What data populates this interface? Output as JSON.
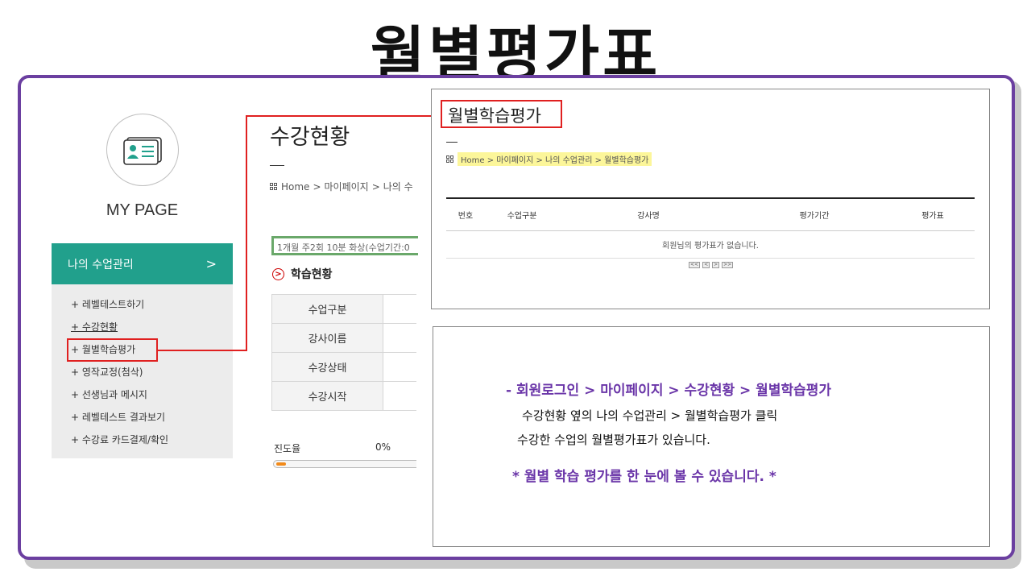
{
  "title": "월별평가표",
  "sidebar": {
    "heading": "MY PAGE",
    "section": "나의 수업관리",
    "section_chevron": ">",
    "items": [
      {
        "label": "+ 레벨테스트하기"
      },
      {
        "label": "+ 수강현황"
      },
      {
        "label": "+ 월별학습평가"
      },
      {
        "label": "+ 영작교정(첨삭)"
      },
      {
        "label": "+ 선생님과 메시지"
      },
      {
        "label": "+ 레벨테스트 결과보기"
      },
      {
        "label": "+ 수강료 카드결제/확인"
      }
    ]
  },
  "middle": {
    "title": "수강현황",
    "breadcrumb": [
      "Home",
      "마이페이지",
      "나의 수"
    ],
    "course_banner": "1개월 주2회 10분 화상(수업기간:0",
    "section_title": "학습현황",
    "rows": [
      {
        "label": "수업구분"
      },
      {
        "label": "강사이름"
      },
      {
        "label": "수강상태"
      },
      {
        "label": "수강시작"
      }
    ],
    "progress_label": "진도율",
    "progress_value": "0%",
    "progress_fraction": 0.07
  },
  "eval_panel": {
    "title": "월별학습평가",
    "breadcrumb": [
      "Home",
      "마이페이지",
      "나의 수업관리",
      "월별학습평가"
    ],
    "columns": [
      "번호",
      "수업구분",
      "강사명",
      "평가기간",
      "평가표"
    ],
    "empty_message": "회원님의 평가표가 없습니다.",
    "pager": [
      "<<",
      "<",
      ">",
      ">>"
    ]
  },
  "instructions": {
    "path": "- 회원로그인 > 마이페이지 > 수강현황 > 월별학습평가",
    "line1": "수강현황 옆의 나의 수업관리 > 월별학습평가 클릭",
    "line2": "수강한 수업의 월별평가표가 있습니다.",
    "note": "* 월별 학습 평가를 한 눈에 볼 수 있습니다. *"
  },
  "colors": {
    "frame": "#6b3fa0",
    "sidebar_header": "#21a08c",
    "highlight": "#e02020",
    "instruction_purple": "#6a35a8",
    "progress_fill": "#f28a1a",
    "breadcrumb_highlight": "#fcf69a"
  }
}
